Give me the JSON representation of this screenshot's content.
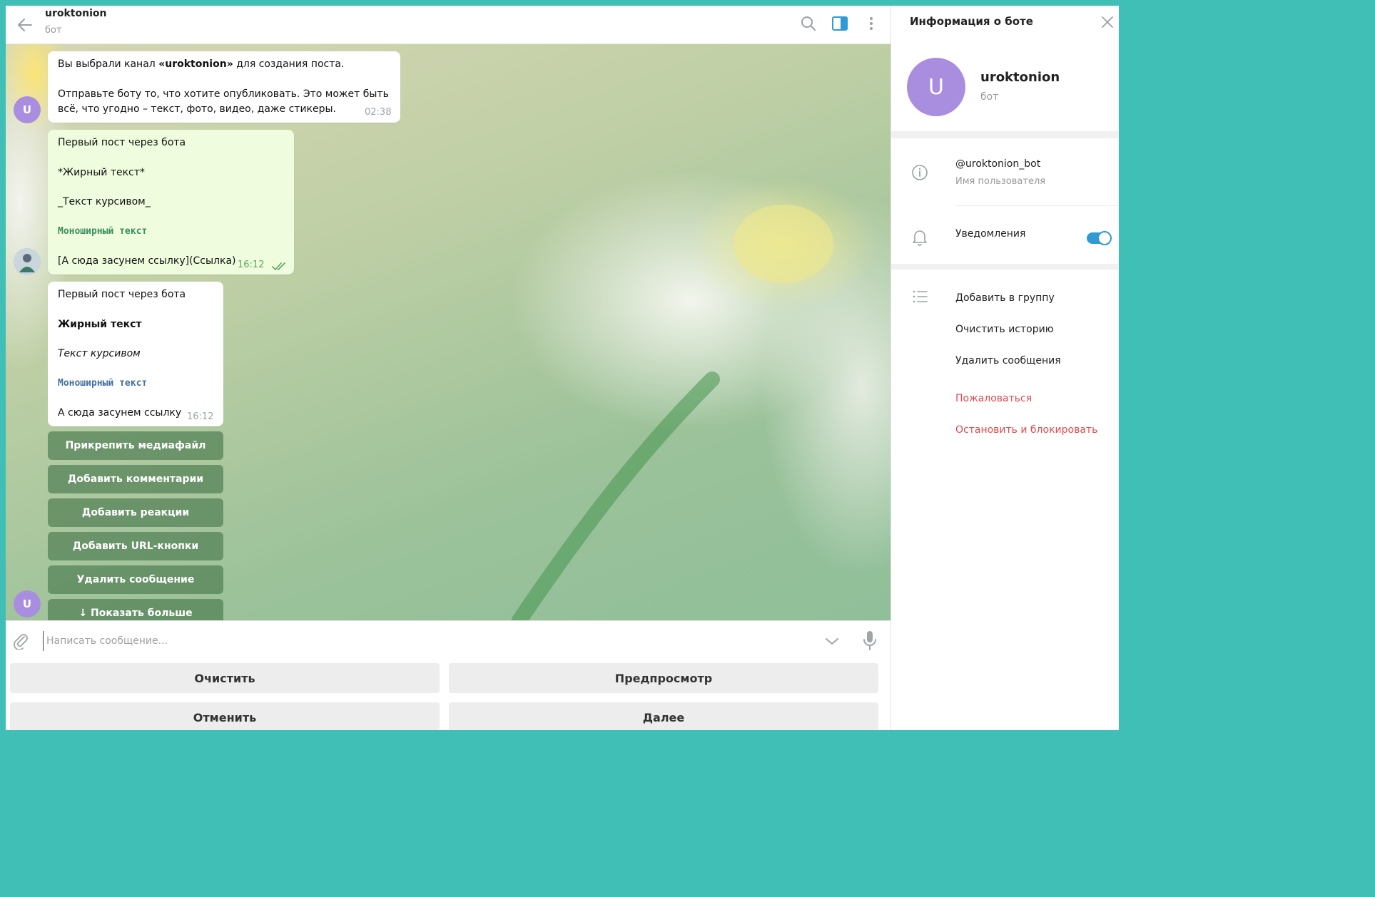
{
  "header": {
    "title": "uroktonion",
    "subtitle": "бот"
  },
  "messages": [
    {
      "direction": "in",
      "parts": [
        "Вы выбрали канал ",
        "«uroktonion»",
        " для создания поста."
      ],
      "line2": "Отправьте боту то, что хотите опубликовать. Это может быть",
      "line3": "всё, что угодно – текст, фото, видео, даже стикеры.",
      "time": "02:38"
    },
    {
      "direction": "out",
      "lines": [
        "Первый пост через бота",
        "*Жирный текст*",
        "_Текст курсивом_",
        "Моноширный текст",
        "[А сюда засунем ссылку](Ссылка)"
      ],
      "time": "16:12",
      "status": "read"
    },
    {
      "direction": "in",
      "lines": [
        "Первый пост через бота",
        "Жирный текст",
        "Текст курсивом",
        "Моноширный текст",
        "А сюда засунем ссылку"
      ],
      "time": "16:12"
    }
  ],
  "avatars": {
    "bot_initial": "U"
  },
  "inline_keyboard": [
    "Прикрепить медиафайл",
    "Добавить комментарии",
    "Добавить реакции",
    "Добавить URL-кнопки",
    "Удалить сообщение",
    "↓ Показать больше"
  ],
  "composer": {
    "placeholder": "Написать сообщение..."
  },
  "reply_keyboard": [
    "Очистить",
    "Предпросмотр",
    "Отменить",
    "Далее"
  ],
  "panel": {
    "title": "Информация о боте",
    "avatar_initial": "U",
    "name": "uroktonion",
    "subtitle": "бот",
    "username": "@uroktonion_bot",
    "username_label": "Имя пользователя",
    "notifications_label": "Уведомления",
    "notifications_on": true,
    "actions": [
      "Добавить в группу",
      "Очистить историю",
      "Удалить сообщения"
    ],
    "danger_actions": [
      "Пожаловаться",
      "Остановить и блокировать"
    ]
  },
  "colors": {
    "accent": "#2e9ad6",
    "avatar": "#a98ee0",
    "danger": "#e5484d",
    "frame": "#3fbfb6",
    "keyboard_button": "#528054"
  }
}
